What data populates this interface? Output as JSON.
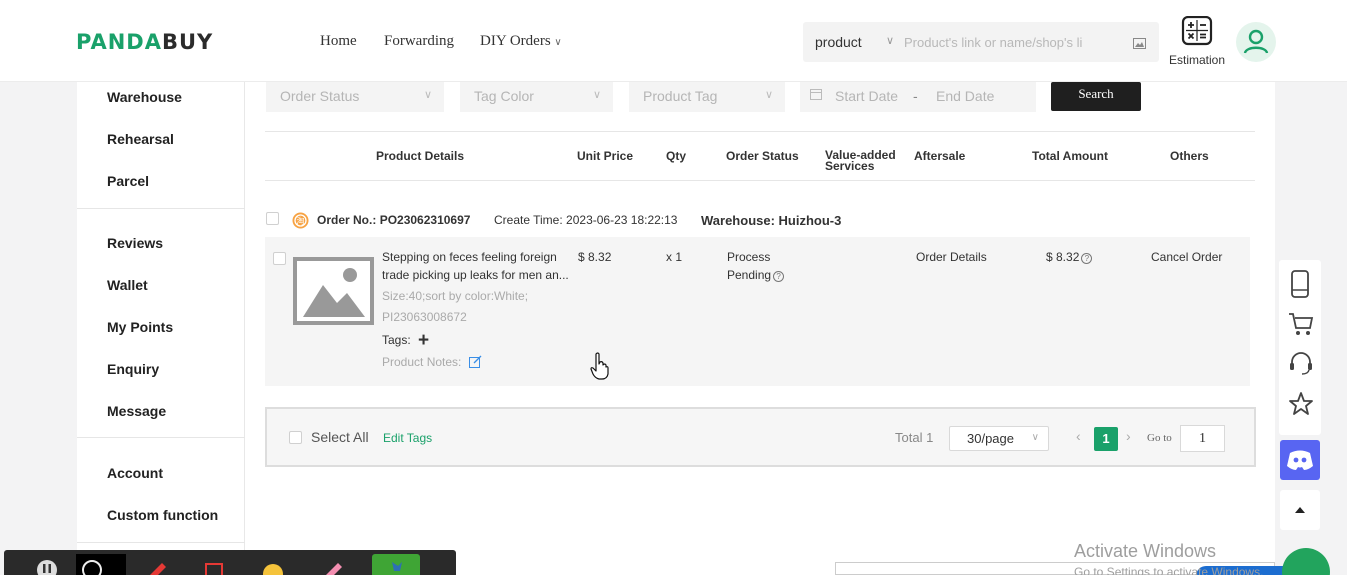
{
  "brand": {
    "logo_part1": "PANDA",
    "logo_part2": "BUY"
  },
  "nav": {
    "home": "Home",
    "forwarding": "Forwarding",
    "diy_orders": "DIY Orders"
  },
  "search": {
    "type": "product",
    "placeholder": "Product's link or name/shop's li"
  },
  "estimation_label": "Estimation",
  "sidebar": {
    "items": [
      "Warehouse",
      "Rehearsal",
      "Parcel",
      "Reviews",
      "Wallet",
      "My Points",
      "Enquiry",
      "Message",
      "Account",
      "Custom function"
    ]
  },
  "filters": {
    "order_status": "Order Status",
    "tag_color": "Tag Color",
    "product_tag": "Product Tag",
    "start_date": "Start Date",
    "date_sep": "-",
    "end_date": "End Date",
    "search_btn": "Search"
  },
  "table": {
    "headers": {
      "product_details": "Product Details",
      "unit_price": "Unit Price",
      "qty": "Qty",
      "order_status": "Order Status",
      "value_added_1": "Value-added",
      "value_added_2": "Services",
      "aftersale": "Aftersale",
      "total_amount": "Total Amount",
      "others": "Others"
    }
  },
  "order": {
    "order_no_label": "Order No.:",
    "order_no": "PO23062310697",
    "create_time_label": "Create Time:",
    "create_time": "2023-06-23 18:22:13",
    "warehouse": "Warehouse: Huizhou-3",
    "item": {
      "title_line1": "Stepping on feces feeling foreign",
      "title_line2": "trade picking up leaks for men an...",
      "spec": "Size:40;sort by color:White;",
      "code": "PI23063008672",
      "tags_label": "Tags:",
      "notes_label": "Product Notes:",
      "unit_price": "$ 8.32",
      "qty": "x 1",
      "status_line1": "Process",
      "status_line2": "Pending",
      "aftersale": "Order Details",
      "total": "$ 8.32",
      "others": "Cancel Order"
    }
  },
  "footer": {
    "select_all": "Select All",
    "edit_tags": "Edit Tags",
    "total": "Total 1",
    "per_page": "30/page",
    "current_page": "1",
    "goto_label": "Go to",
    "goto_value": "1"
  },
  "windows": {
    "activate_title": "Activate Windows",
    "activate_sub": "Go to Settings to activate Windows."
  },
  "colors": {
    "brand_green": "#1aa16a",
    "discord": "#5865f2",
    "dark_button": "#1f1f1f"
  }
}
